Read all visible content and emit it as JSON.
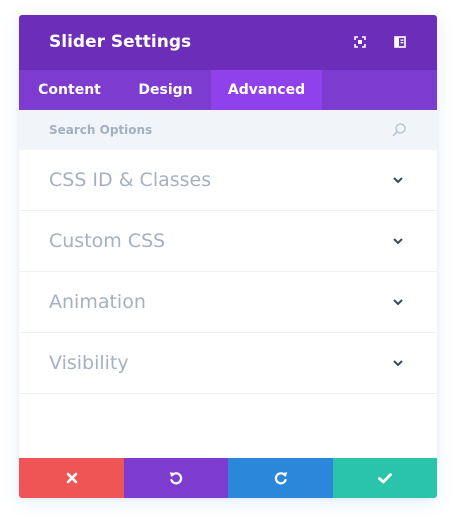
{
  "header": {
    "title": "Slider Settings",
    "icons": [
      "fullscreen-icon",
      "sidebar-icon"
    ]
  },
  "tabs": [
    {
      "label": "Content",
      "active": false
    },
    {
      "label": "Design",
      "active": false
    },
    {
      "label": "Advanced",
      "active": true
    }
  ],
  "search": {
    "placeholder": "Search Options",
    "icon": "search-icon"
  },
  "toggles": [
    {
      "label": "CSS ID & Classes"
    },
    {
      "label": "Custom CSS"
    },
    {
      "label": "Animation"
    },
    {
      "label": "Visibility"
    }
  ],
  "footer": {
    "buttons": [
      {
        "icon": "close-icon",
        "color": "#ef5555"
      },
      {
        "icon": "undo-icon",
        "color": "#7e3bd0"
      },
      {
        "icon": "redo-icon",
        "color": "#2b87da"
      },
      {
        "icon": "check-icon",
        "color": "#29c4a9"
      }
    ]
  },
  "colors": {
    "header_bg": "#6c2eb9",
    "tabs_bg": "#7e3bd0",
    "active_tab_bg": "#8f42ec",
    "search_bg": "#f1f5f9",
    "label_text": "#a4b1c2"
  }
}
